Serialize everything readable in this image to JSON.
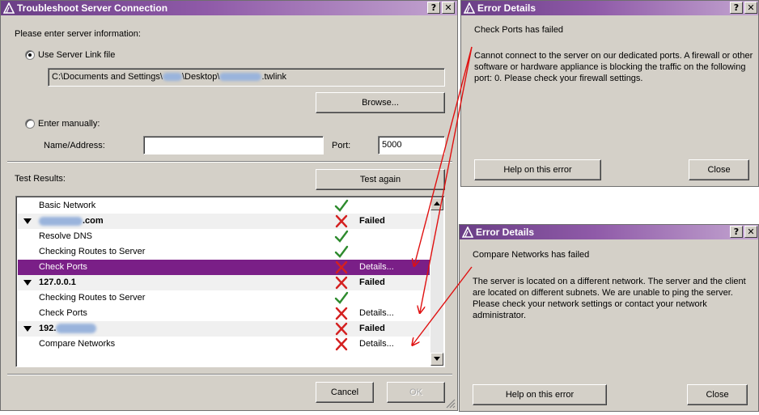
{
  "main_dialog": {
    "title": "Troubleshoot Server Connection",
    "help_button": "?",
    "close_button": "✕",
    "prompt": "Please enter server information:",
    "use_link_file_label": "Use Server Link file",
    "link_file_path_prefix": "C:\\Documents and Settings\\",
    "link_file_path_middle": "\\Desktop\\",
    "link_file_path_suffix": ".twlink",
    "browse_button": "Browse...",
    "enter_manually_label": "Enter manually:",
    "name_address_label": "Name/Address:",
    "name_address_value": "",
    "port_label": "Port:",
    "port_value": "5000",
    "test_results_label": "Test Results:",
    "test_again_button": "Test again",
    "cancel_button": "Cancel",
    "ok_button": "OK",
    "results": [
      {
        "name": "Basic Network",
        "status": "pass",
        "result": "",
        "group": false,
        "selected": false
      },
      {
        "name": ".com",
        "status": "fail",
        "result": "Failed",
        "group": true,
        "selected": false,
        "blurred_prefix": true
      },
      {
        "name": "Resolve DNS",
        "status": "pass",
        "result": "",
        "group": false,
        "selected": false
      },
      {
        "name": "Checking Routes to Server",
        "status": "pass",
        "result": "",
        "group": false,
        "selected": false
      },
      {
        "name": "Check Ports",
        "status": "fail",
        "result": "Details...",
        "group": false,
        "selected": true
      },
      {
        "name": "127.0.0.1",
        "status": "fail",
        "result": "Failed",
        "group": true,
        "selected": false
      },
      {
        "name": "Checking Routes to Server",
        "status": "pass",
        "result": "",
        "group": false,
        "selected": false
      },
      {
        "name": "Check Ports",
        "status": "fail",
        "result": "Details...",
        "group": false,
        "selected": false
      },
      {
        "name": "192.",
        "status": "fail",
        "result": "Failed",
        "group": true,
        "selected": false,
        "blurred_suffix": true
      },
      {
        "name": "Compare Networks",
        "status": "fail",
        "result": "Details...",
        "group": false,
        "selected": false
      }
    ]
  },
  "error_dialog_1": {
    "title": "Error Details",
    "help_button": "?",
    "close_button": "✕",
    "heading": "Check Ports has failed",
    "message": "Cannot connect to the server on our dedicated ports. A firewall or other software or hardware appliance is blocking the traffic on the following port:  0. Please check your firewall settings.",
    "help_on_error_button": "Help on this error",
    "close_dialog_button": "Close"
  },
  "error_dialog_2": {
    "title": "Error Details",
    "help_button": "?",
    "close_button": "✕",
    "heading": "Compare Networks has failed",
    "message": "The server is located on a different network. The server and the client are located on different subnets.  We are unable to ping the server. Please check your network settings or contact your network administrator.",
    "help_on_error_button": "Help on this error",
    "close_dialog_button": "Close"
  },
  "colors": {
    "title_gradient_start": "#6a3e86",
    "selected_row": "#7a1f87",
    "pass_check": "#2e8b2e",
    "fail_cross": "#d42020",
    "annotation_arrow": "#e01010"
  },
  "icons": {
    "app": "archicad-logo-icon",
    "pass": "check-icon",
    "fail": "cross-icon"
  }
}
